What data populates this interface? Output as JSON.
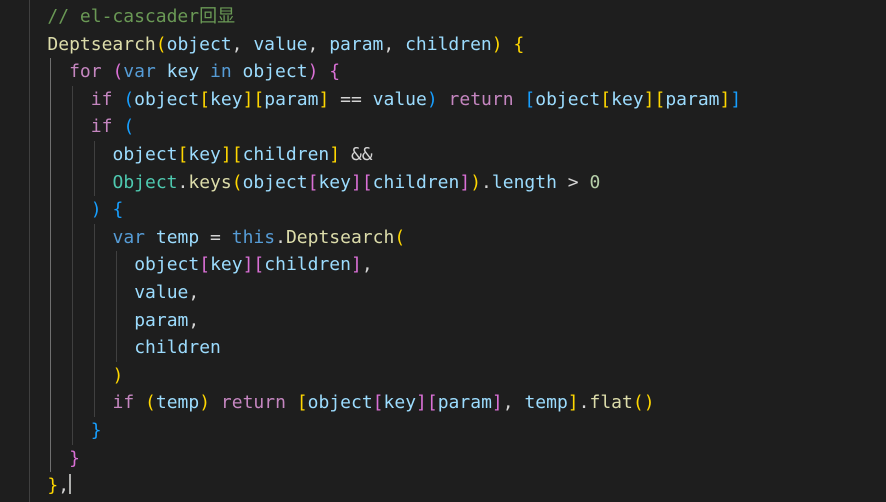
{
  "editor": {
    "lines": [
      {
        "indent": 2,
        "tokens": [
          {
            "t": "// el-cascader回显",
            "c": "c"
          }
        ]
      },
      {
        "indent": 2,
        "tokens": [
          {
            "t": "Deptsearch",
            "c": "fn"
          },
          {
            "t": "(",
            "c": "b1"
          },
          {
            "t": "object",
            "c": "v"
          },
          {
            "t": ", ",
            "c": "p"
          },
          {
            "t": "value",
            "c": "v"
          },
          {
            "t": ", ",
            "c": "p"
          },
          {
            "t": "param",
            "c": "v"
          },
          {
            "t": ", ",
            "c": "p"
          },
          {
            "t": "children",
            "c": "v"
          },
          {
            "t": ")",
            "c": "b1"
          },
          {
            "t": " ",
            "c": "p"
          },
          {
            "t": "{",
            "c": "b1"
          }
        ]
      },
      {
        "indent": 3,
        "tokens": [
          {
            "t": "for",
            "c": "kw"
          },
          {
            "t": " ",
            "c": "p"
          },
          {
            "t": "(",
            "c": "b2"
          },
          {
            "t": "var",
            "c": "st"
          },
          {
            "t": " ",
            "c": "p"
          },
          {
            "t": "key",
            "c": "v"
          },
          {
            "t": " ",
            "c": "p"
          },
          {
            "t": "in",
            "c": "st"
          },
          {
            "t": " ",
            "c": "p"
          },
          {
            "t": "object",
            "c": "v"
          },
          {
            "t": ")",
            "c": "b2"
          },
          {
            "t": " ",
            "c": "p"
          },
          {
            "t": "{",
            "c": "b2"
          }
        ]
      },
      {
        "indent": 4,
        "tokens": [
          {
            "t": "if",
            "c": "kw"
          },
          {
            "t": " ",
            "c": "p"
          },
          {
            "t": "(",
            "c": "b3"
          },
          {
            "t": "object",
            "c": "v"
          },
          {
            "t": "[",
            "c": "b1"
          },
          {
            "t": "key",
            "c": "v"
          },
          {
            "t": "]",
            "c": "b1"
          },
          {
            "t": "[",
            "c": "b1"
          },
          {
            "t": "param",
            "c": "v"
          },
          {
            "t": "]",
            "c": "b1"
          },
          {
            "t": " == ",
            "c": "p"
          },
          {
            "t": "value",
            "c": "v"
          },
          {
            "t": ")",
            "c": "b3"
          },
          {
            "t": " ",
            "c": "p"
          },
          {
            "t": "return",
            "c": "kw"
          },
          {
            "t": " ",
            "c": "p"
          },
          {
            "t": "[",
            "c": "b3"
          },
          {
            "t": "object",
            "c": "v"
          },
          {
            "t": "[",
            "c": "b1"
          },
          {
            "t": "key",
            "c": "v"
          },
          {
            "t": "]",
            "c": "b1"
          },
          {
            "t": "[",
            "c": "b1"
          },
          {
            "t": "param",
            "c": "v"
          },
          {
            "t": "]",
            "c": "b1"
          },
          {
            "t": "]",
            "c": "b3"
          }
        ]
      },
      {
        "indent": 4,
        "tokens": [
          {
            "t": "if",
            "c": "kw"
          },
          {
            "t": " ",
            "c": "p"
          },
          {
            "t": "(",
            "c": "b3"
          }
        ]
      },
      {
        "indent": 5,
        "tokens": [
          {
            "t": "object",
            "c": "v"
          },
          {
            "t": "[",
            "c": "b1"
          },
          {
            "t": "key",
            "c": "v"
          },
          {
            "t": "]",
            "c": "b1"
          },
          {
            "t": "[",
            "c": "b1"
          },
          {
            "t": "children",
            "c": "v"
          },
          {
            "t": "]",
            "c": "b1"
          },
          {
            "t": " &&",
            "c": "p"
          }
        ]
      },
      {
        "indent": 5,
        "tokens": [
          {
            "t": "Object",
            "c": "ty"
          },
          {
            "t": ".",
            "c": "p"
          },
          {
            "t": "keys",
            "c": "fn"
          },
          {
            "t": "(",
            "c": "b1"
          },
          {
            "t": "object",
            "c": "v"
          },
          {
            "t": "[",
            "c": "b2"
          },
          {
            "t": "key",
            "c": "v"
          },
          {
            "t": "]",
            "c": "b2"
          },
          {
            "t": "[",
            "c": "b2"
          },
          {
            "t": "children",
            "c": "v"
          },
          {
            "t": "]",
            "c": "b2"
          },
          {
            "t": ")",
            "c": "b1"
          },
          {
            "t": ".",
            "c": "p"
          },
          {
            "t": "length",
            "c": "v"
          },
          {
            "t": " > ",
            "c": "p"
          },
          {
            "t": "0",
            "c": "n"
          }
        ]
      },
      {
        "indent": 4,
        "tokens": [
          {
            "t": ")",
            "c": "b3"
          },
          {
            "t": " ",
            "c": "p"
          },
          {
            "t": "{",
            "c": "b3"
          }
        ]
      },
      {
        "indent": 5,
        "tokens": [
          {
            "t": "var",
            "c": "st"
          },
          {
            "t": " ",
            "c": "p"
          },
          {
            "t": "temp",
            "c": "v"
          },
          {
            "t": " = ",
            "c": "p"
          },
          {
            "t": "this",
            "c": "st"
          },
          {
            "t": ".",
            "c": "p"
          },
          {
            "t": "Deptsearch",
            "c": "fn"
          },
          {
            "t": "(",
            "c": "b1"
          }
        ]
      },
      {
        "indent": 6,
        "tokens": [
          {
            "t": "object",
            "c": "v"
          },
          {
            "t": "[",
            "c": "b2"
          },
          {
            "t": "key",
            "c": "v"
          },
          {
            "t": "]",
            "c": "b2"
          },
          {
            "t": "[",
            "c": "b2"
          },
          {
            "t": "children",
            "c": "v"
          },
          {
            "t": "]",
            "c": "b2"
          },
          {
            "t": ",",
            "c": "p"
          }
        ]
      },
      {
        "indent": 6,
        "tokens": [
          {
            "t": "value",
            "c": "v"
          },
          {
            "t": ",",
            "c": "p"
          }
        ]
      },
      {
        "indent": 6,
        "tokens": [
          {
            "t": "param",
            "c": "v"
          },
          {
            "t": ",",
            "c": "p"
          }
        ]
      },
      {
        "indent": 6,
        "tokens": [
          {
            "t": "children",
            "c": "v"
          }
        ]
      },
      {
        "indent": 5,
        "tokens": [
          {
            "t": ")",
            "c": "b1"
          }
        ]
      },
      {
        "indent": 5,
        "tokens": [
          {
            "t": "if",
            "c": "kw"
          },
          {
            "t": " ",
            "c": "p"
          },
          {
            "t": "(",
            "c": "b1"
          },
          {
            "t": "temp",
            "c": "v"
          },
          {
            "t": ")",
            "c": "b1"
          },
          {
            "t": " ",
            "c": "p"
          },
          {
            "t": "return",
            "c": "kw"
          },
          {
            "t": " ",
            "c": "p"
          },
          {
            "t": "[",
            "c": "b1"
          },
          {
            "t": "object",
            "c": "v"
          },
          {
            "t": "[",
            "c": "b2"
          },
          {
            "t": "key",
            "c": "v"
          },
          {
            "t": "]",
            "c": "b2"
          },
          {
            "t": "[",
            "c": "b2"
          },
          {
            "t": "param",
            "c": "v"
          },
          {
            "t": "]",
            "c": "b2"
          },
          {
            "t": ", ",
            "c": "p"
          },
          {
            "t": "temp",
            "c": "v"
          },
          {
            "t": "]",
            "c": "b1"
          },
          {
            "t": ".",
            "c": "p"
          },
          {
            "t": "flat",
            "c": "fn"
          },
          {
            "t": "(",
            "c": "b1"
          },
          {
            "t": ")",
            "c": "b1"
          }
        ]
      },
      {
        "indent": 4,
        "tokens": [
          {
            "t": "}",
            "c": "b3"
          }
        ]
      },
      {
        "indent": 3,
        "tokens": [
          {
            "t": "}",
            "c": "b2"
          }
        ]
      },
      {
        "indent": 2,
        "tokens": [
          {
            "t": "}",
            "c": "b1"
          },
          {
            "t": ",",
            "c": "p"
          }
        ]
      }
    ],
    "cursor_line": 17,
    "active_guide_indent": 2
  }
}
